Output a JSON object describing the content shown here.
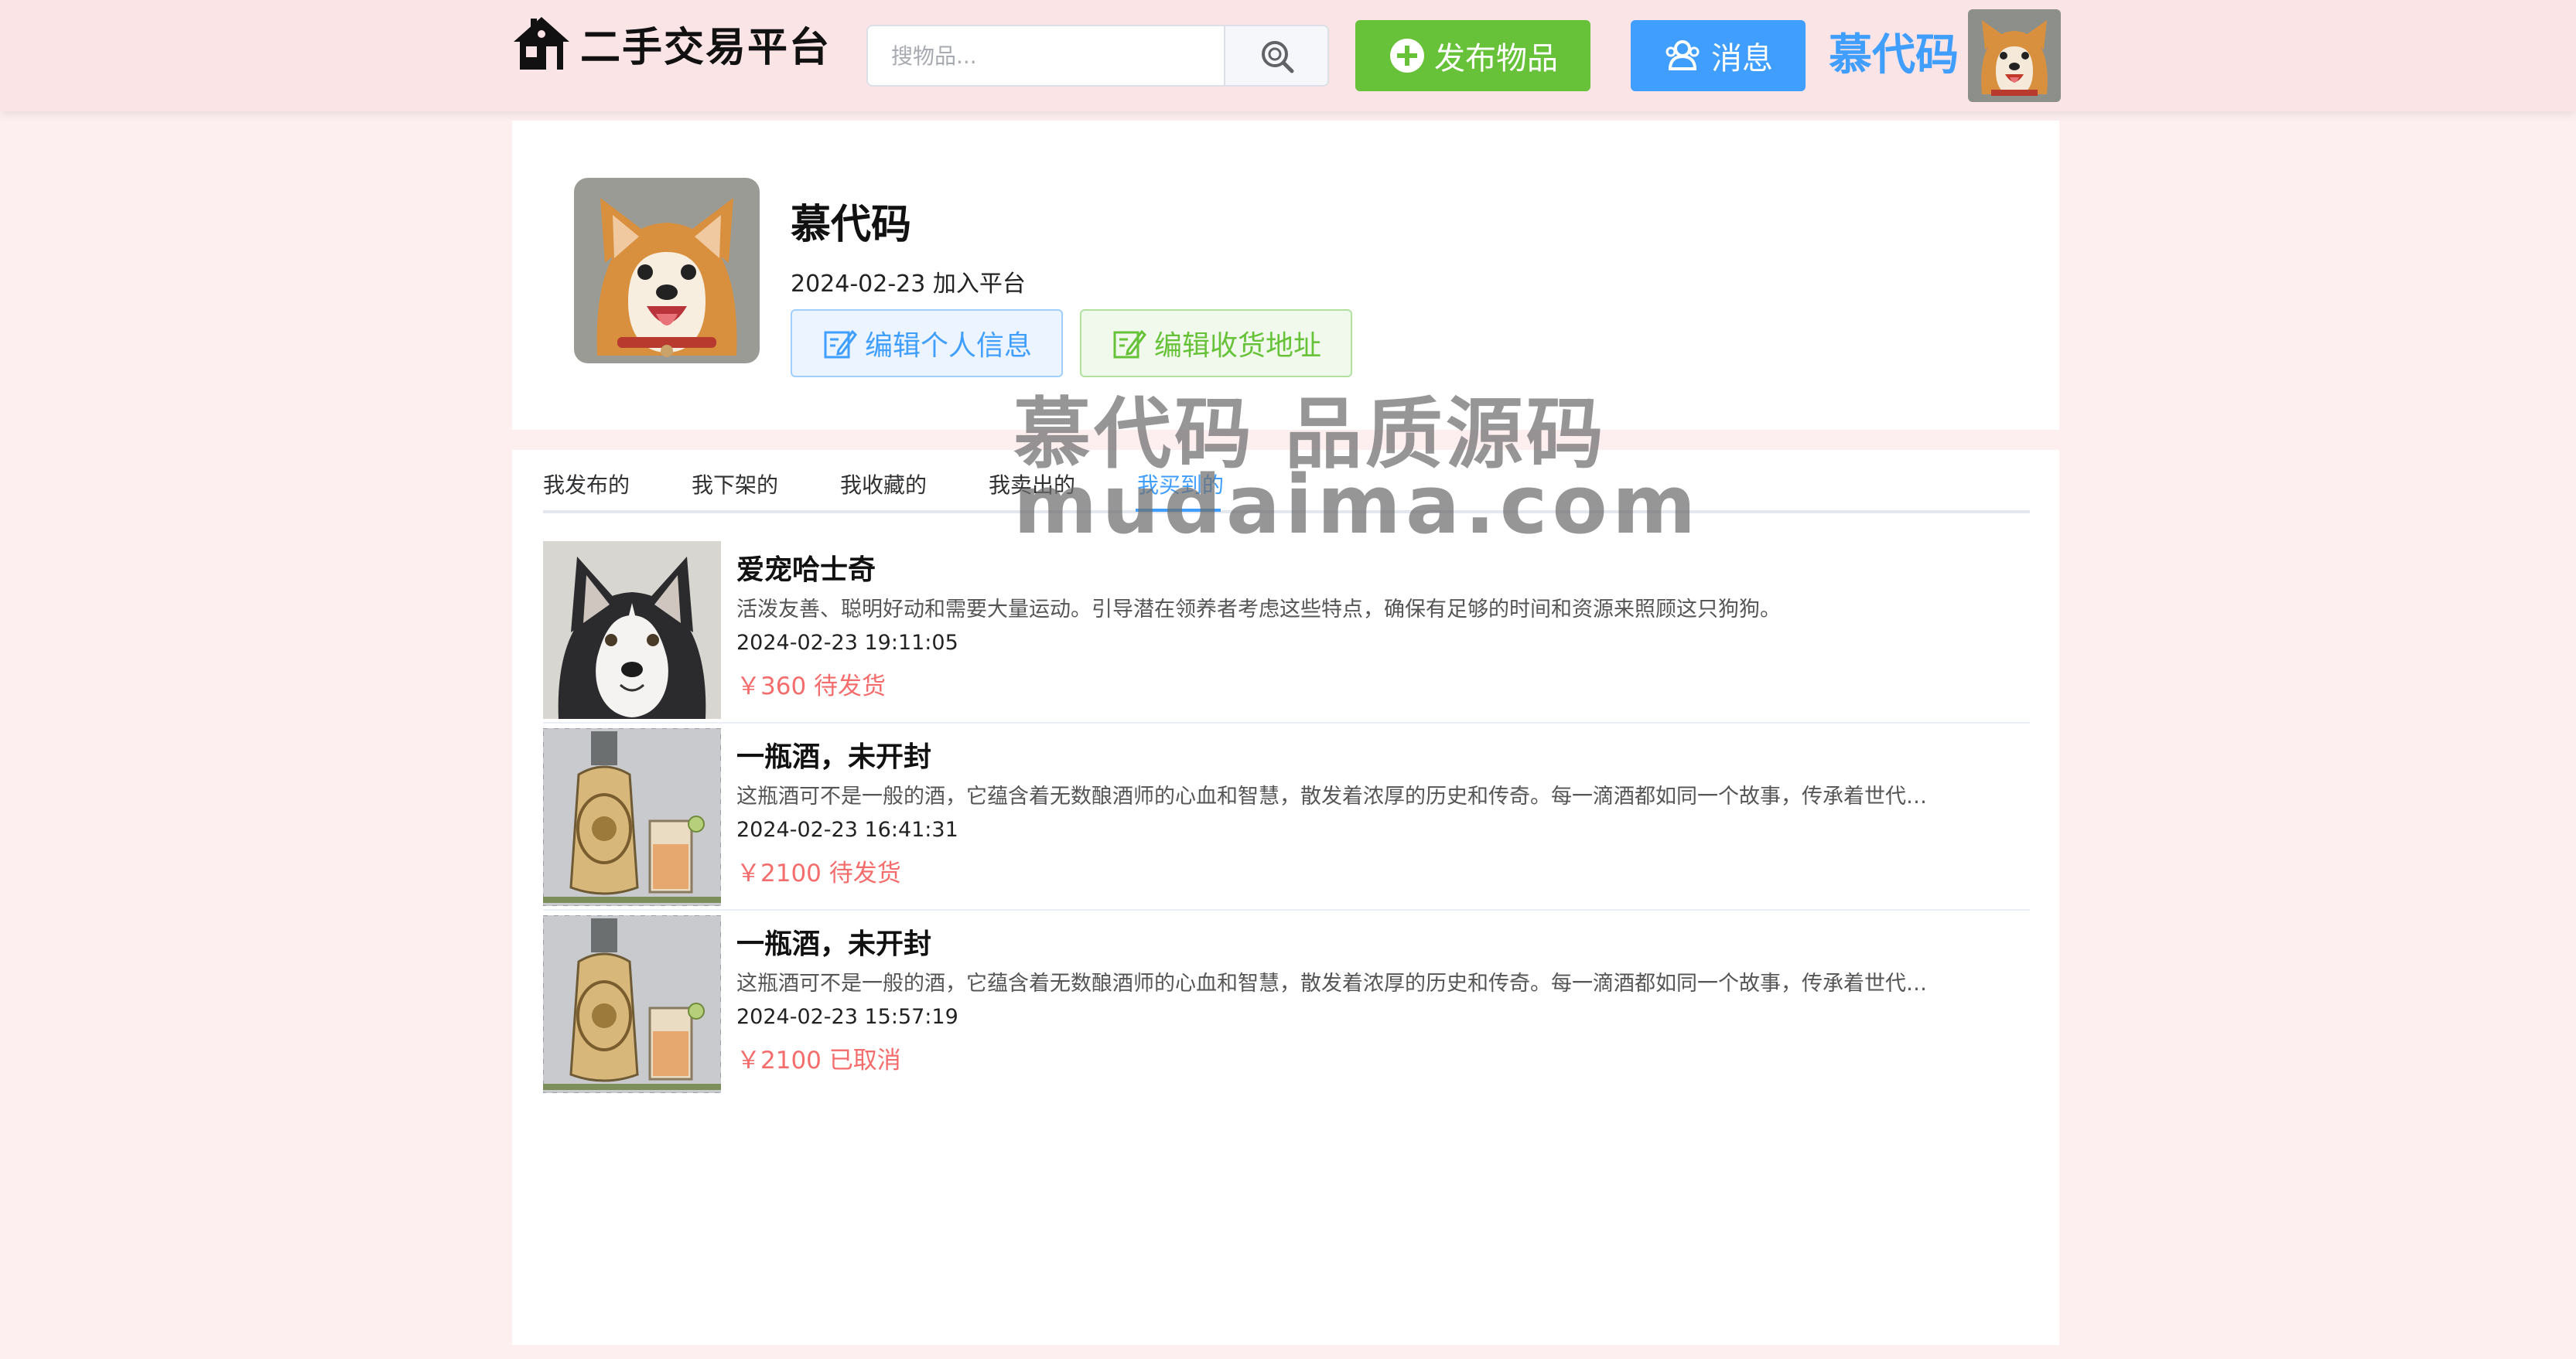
{
  "header": {
    "logo_text": "二手交易平台",
    "search_placeholder": "搜物品...",
    "publish_label": "发布物品",
    "message_label": "消息",
    "username": "慕代码"
  },
  "profile": {
    "name": "慕代码",
    "joined": "2024-02-23 加入平台",
    "edit_info_label": "编辑个人信息",
    "edit_address_label": "编辑收货地址"
  },
  "tabs": [
    "我发布的",
    "我下架的",
    "我收藏的",
    "我卖出的",
    "我买到的"
  ],
  "active_tab": "我买到的",
  "items": [
    {
      "title": "爱宠哈士奇",
      "description": "活泼友善、聪明好动和需要大量运动。引导潜在领养者考虑这些特点，确保有足够的时间和资源来照顾这只狗狗。",
      "time": "2024-02-23 19:11:05",
      "price": "￥360",
      "status": "待发货"
    },
    {
      "title": "一瓶酒，未开封",
      "description": "这瓶酒可不是一般的酒，它蕴含着无数酿酒师的心血和智慧，散发着浓厚的历史和传奇。每一滴酒都如同一个故事，传承着世代…",
      "time": "2024-02-23 16:41:31",
      "price": "￥2100",
      "status": "待发货"
    },
    {
      "title": "一瓶酒，未开封",
      "description": "这瓶酒可不是一般的酒，它蕴含着无数酿酒师的心血和智慧，散发着浓厚的历史和传奇。每一滴酒都如同一个故事，传承着世代…",
      "time": "2024-02-23 15:57:19",
      "price": "￥2100",
      "status": "已取消"
    }
  ],
  "watermark": {
    "line1": "慕代码 品质源码",
    "line2": "mudaima.com"
  },
  "colors": {
    "header_bg": "#fbe4e6",
    "page_bg": "#fdeef0",
    "primary": "#409eff",
    "success": "#67c23a",
    "price": "#f56c6c"
  },
  "icons": [
    "house-icon",
    "search-icon",
    "plus-circle-icon",
    "users-icon",
    "edit-icon"
  ]
}
